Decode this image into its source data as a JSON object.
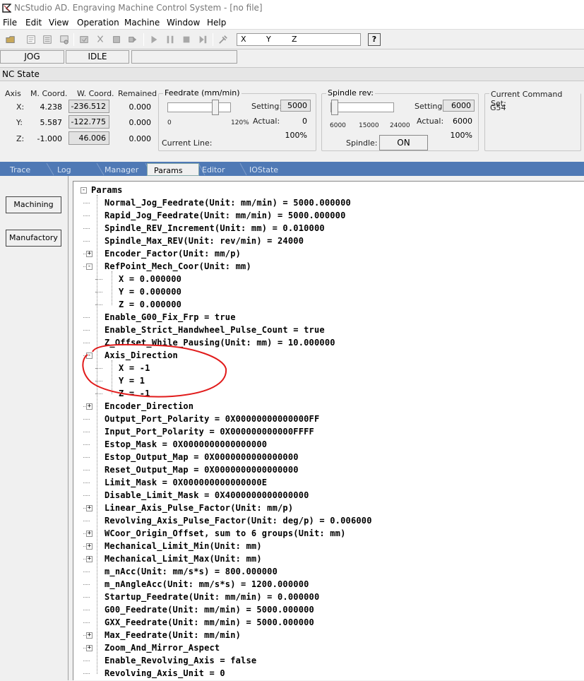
{
  "window": {
    "title": "NcStudio AD. Engraving Machine Control System  - [no file]"
  },
  "menu": [
    "File",
    "Edit",
    "View",
    "Operation",
    "Machine",
    "Window",
    "Help"
  ],
  "toolbar": {
    "coord_labels": [
      "X",
      "Y",
      "Z"
    ],
    "help_label": "?"
  },
  "status": {
    "mode": "JOG",
    "state": "IDLE",
    "extra": ""
  },
  "nc_state": {
    "title": "NC State",
    "headers": {
      "axis": "Axis",
      "mcoord": "M. Coord.",
      "wcoord": "W. Coord.",
      "remained": "Remained"
    },
    "rows": [
      {
        "axis": "X:",
        "m": "4.238",
        "w": "-236.512",
        "r": "0.000"
      },
      {
        "axis": "Y:",
        "m": "5.587",
        "w": "-122.775",
        "r": "0.000"
      },
      {
        "axis": "Z:",
        "m": "-1.000",
        "w": "46.006",
        "r": "0.000"
      }
    ],
    "feedrate": {
      "title": "Feedrate (mm/min)",
      "setting_label": "Setting:",
      "setting": "5000",
      "actual_label": "Actual:",
      "actual": "0",
      "percent": "100%",
      "scale_min": "0",
      "scale_max": "120%",
      "current_line_label": "Current Line:",
      "slider_level": 0.7
    },
    "spindle": {
      "title": "Spindle rev:",
      "setting_label": "Setting:",
      "setting": "6000",
      "actual_label": "Actual:",
      "actual": "6000",
      "percent": "100%",
      "ticks": [
        "6000",
        "15000",
        "24000"
      ],
      "spindle_label": "Spindle:",
      "spindle_button": "ON",
      "slider_level": 0.0
    },
    "command_set": {
      "title": "Current Command Set:",
      "value": "G54"
    }
  },
  "tabs": [
    "Trace",
    "Log",
    "Manager",
    "Params",
    "Editor",
    "IOState"
  ],
  "active_tab": "Params",
  "left_buttons": [
    "Machining",
    "Manufactory"
  ],
  "tree": [
    {
      "text": "Params",
      "level": 0,
      "expander": "-"
    },
    {
      "text": "Normal_Jog_Feedrate(Unit: mm/min) = 5000.000000",
      "level": 1
    },
    {
      "text": "Rapid_Jog_Feedrate(Unit: mm/min) = 5000.000000",
      "level": 1
    },
    {
      "text": "Spindle_REV_Increment(Unit: mm) = 0.010000",
      "level": 1
    },
    {
      "text": "Spindle_Max_REV(Unit: rev/min) = 24000",
      "level": 1
    },
    {
      "text": "Encoder_Factor(Unit: mm/p)",
      "level": 1,
      "expander": "+"
    },
    {
      "text": "RefPoint_Mech_Coor(Unit: mm)",
      "level": 1,
      "expander": "-"
    },
    {
      "text": "X = 0.000000",
      "level": 2
    },
    {
      "text": "Y = 0.000000",
      "level": 2
    },
    {
      "text": "Z = 0.000000",
      "level": 2
    },
    {
      "text": "Enable_G00_Fix_Frp = true",
      "level": 1
    },
    {
      "text": "Enable_Strict_Handwheel_Pulse_Count = true",
      "level": 1
    },
    {
      "text": "Z_Offset_While_Pausing(Unit: mm) = 10.000000",
      "level": 1
    },
    {
      "text": "Axis_Direction",
      "level": 1,
      "expander": "-"
    },
    {
      "text": "X = -1",
      "level": 2
    },
    {
      "text": "Y = 1",
      "level": 2
    },
    {
      "text": "Z = -1",
      "level": 2
    },
    {
      "text": "Encoder_Direction",
      "level": 1,
      "expander": "+"
    },
    {
      "text": "Output_Port_Polarity = 0X00000000000000FF",
      "level": 1
    },
    {
      "text": "Input_Port_Polarity = 0X000000000000FFFF",
      "level": 1
    },
    {
      "text": "Estop_Mask = 0X0000000000000000",
      "level": 1
    },
    {
      "text": "Estop_Output_Map = 0X0000000000000000",
      "level": 1
    },
    {
      "text": "Reset_Output_Map = 0X0000000000000000",
      "level": 1
    },
    {
      "text": "Limit_Mask = 0X000000000000000E",
      "level": 1
    },
    {
      "text": "Disable_Limit_Mask = 0X4000000000000000",
      "level": 1
    },
    {
      "text": "Linear_Axis_Pulse_Factor(Unit: mm/p)",
      "level": 1,
      "expander": "+"
    },
    {
      "text": "Revolving_Axis_Pulse_Factor(Unit: deg/p) = 0.006000",
      "level": 1
    },
    {
      "text": "WCoor_Origin_Offset, sum to 6 groups(Unit: mm)",
      "level": 1,
      "expander": "+"
    },
    {
      "text": "Mechanical_Limit_Min(Unit: mm)",
      "level": 1,
      "expander": "+"
    },
    {
      "text": "Mechanical_Limit_Max(Unit: mm)",
      "level": 1,
      "expander": "+"
    },
    {
      "text": "m_nAcc(Unit: mm/s*s) = 800.000000",
      "level": 1
    },
    {
      "text": "m_nAngleAcc(Unit: mm/s*s) = 1200.000000",
      "level": 1
    },
    {
      "text": "Startup_Feedrate(Unit: mm/min) = 0.000000",
      "level": 1
    },
    {
      "text": "G00_Feedrate(Unit: mm/min) = 5000.000000",
      "level": 1
    },
    {
      "text": "GXX_Feedrate(Unit: mm/min) = 5000.000000",
      "level": 1
    },
    {
      "text": "Max_Feedrate(Unit: mm/min)",
      "level": 1,
      "expander": "+"
    },
    {
      "text": "Zoom_And_Mirror_Aspect",
      "level": 1,
      "expander": "+"
    },
    {
      "text": "Enable_Revolving_Axis = false",
      "level": 1
    },
    {
      "text": "Revolving_Axis_Unit = 0",
      "level": 1
    }
  ],
  "colors": {
    "tabstrip": "#4f79b5",
    "highlight_ellipse": "#e11b1b"
  }
}
